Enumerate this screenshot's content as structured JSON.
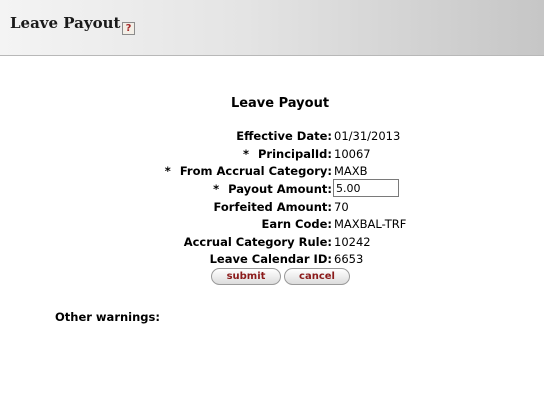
{
  "header": {
    "title": "Leave Payout",
    "help_icon": "?"
  },
  "form": {
    "title": "Leave Payout",
    "fields": {
      "effective_date": {
        "label": "Effective Date:",
        "value": "01/31/2013"
      },
      "principal_id": {
        "required_mark": "*",
        "label": "PrincipalId:",
        "value": "10067"
      },
      "from_accrual_category": {
        "required_mark": "*",
        "label": "From Accrual Category:",
        "value": "MAXB"
      },
      "payout_amount": {
        "required_mark": "*",
        "label": "Payout Amount:",
        "value": "5.00"
      },
      "forfeited_amount": {
        "label": "Forfeited Amount:",
        "value": "70"
      },
      "earn_code": {
        "label": "Earn Code:",
        "value": "MAXBAL-TRF"
      },
      "accrual_category_rule": {
        "label": "Accrual Category Rule:",
        "value": "10242"
      },
      "leave_calendar_id": {
        "label": "Leave Calendar ID:",
        "value": "6653"
      }
    },
    "buttons": {
      "submit": "submit",
      "cancel": "cancel"
    }
  },
  "warnings": {
    "label": "Other warnings:"
  },
  "colors": {
    "button_text": "#8b1a1a",
    "help_icon_text": "#a52a2a"
  }
}
